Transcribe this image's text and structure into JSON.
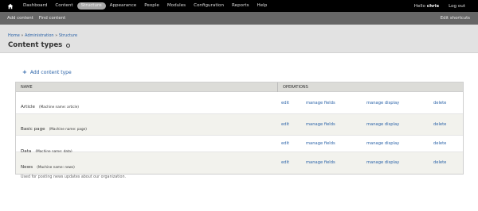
{
  "toolbar": {
    "home_icon": "home-icon",
    "menu": [
      "Dashboard",
      "Content",
      "Structure",
      "Appearance",
      "People",
      "Modules",
      "Configuration",
      "Reports",
      "Help"
    ],
    "active": "Structure",
    "greeting": "Hello",
    "username": "chris",
    "logout": "Log out"
  },
  "shortcuts": {
    "add_content": "Add content",
    "find_content": "Find content",
    "edit_shortcuts": "Edit shortcuts"
  },
  "breadcrumb": [
    "Home",
    "Administration",
    "Structure"
  ],
  "breadcrumb_sep": "»",
  "page_title": "Content types",
  "add_link": "Add content type",
  "table": {
    "headers": {
      "name": "NAME",
      "operations": "OPERATIONS"
    },
    "rows": [
      {
        "name": "Article",
        "machine": "(Machine name: article)",
        "description": "Use articles for time-sensitive content like news, press releases or blog posts.",
        "ops": [
          "edit",
          "manage fields",
          "manage display",
          "delete"
        ]
      },
      {
        "name": "Basic page",
        "machine": "(Machine name: page)",
        "description": "Use basic pages for your static content, such as an 'About us' page.",
        "ops": [
          "edit",
          "manage fields",
          "manage display",
          "delete"
        ]
      },
      {
        "name": "Data",
        "machine": "(Machine name: data)",
        "description": "",
        "ops": [
          "edit",
          "manage fields",
          "manage display",
          "delete"
        ]
      },
      {
        "name": "News",
        "machine": "(Machine name: news)",
        "description": "Used for posting news updates about our organization.",
        "ops": [
          "edit",
          "manage fields",
          "manage display",
          "delete"
        ]
      }
    ]
  },
  "colors": {
    "link": "#2b63a8",
    "toolbar": "#000000",
    "shortcut_bar": "#666666",
    "header_band": "#e2e2e2"
  }
}
